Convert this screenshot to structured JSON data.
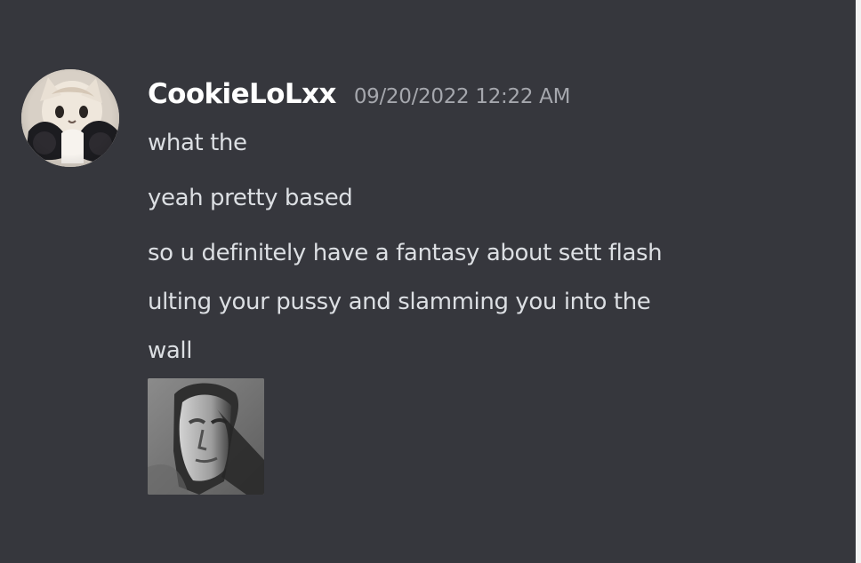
{
  "message": {
    "author": {
      "name": "CookieLoLxx",
      "avatar_icon": "cat-avatar-icon"
    },
    "timestamp": "09/20/2022 12:22 AM",
    "lines": [
      "what the",
      "yeah pretty based",
      "so u definitely have a fantasy about sett flash ulting your pussy and slamming you into the wall"
    ],
    "wrapped_display": [
      "so u definitely have a fantasy about sett flash",
      "ulting your pussy and slamming you into the",
      "wall"
    ],
    "attachment": {
      "type": "image",
      "icon": "portrait-image-icon"
    }
  },
  "theme": {
    "background": "#36373d",
    "username_color": "#ffffff",
    "timestamp_color": "#a5a7ad",
    "message_text_color": "#dcdfe3"
  }
}
